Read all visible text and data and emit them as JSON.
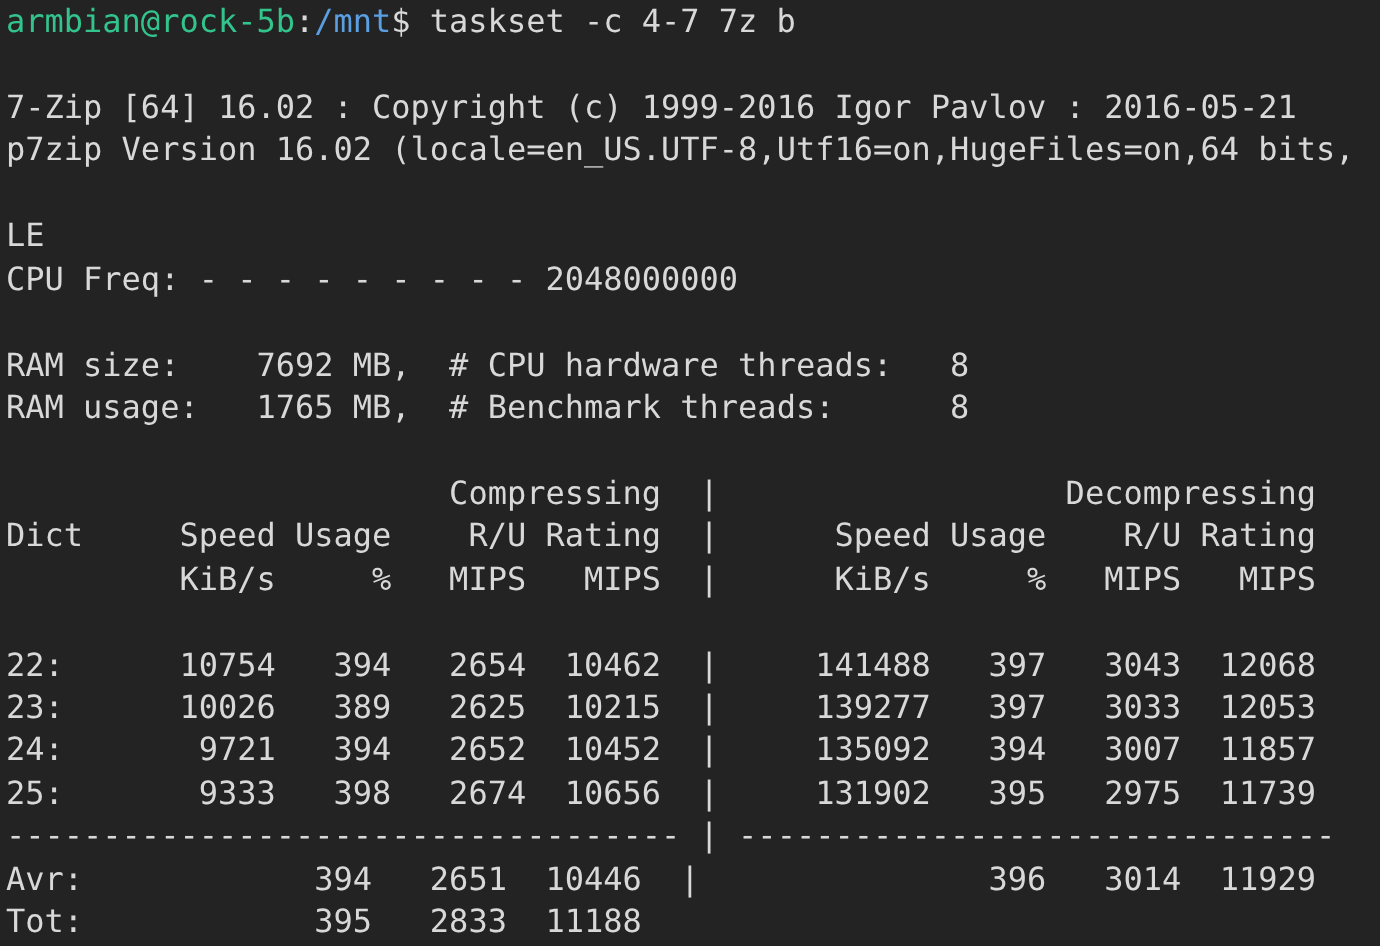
{
  "terminal": {
    "lines": [
      {
        "kind": "prompt",
        "user_host": "armbian@rock-5b",
        "separator": ":",
        "path": "/mnt",
        "symbol": "$",
        "command": "taskset -c 4-7 7z b"
      },
      {
        "kind": "blank"
      },
      {
        "kind": "text",
        "text": "7-Zip [64] 16.02 : Copyright (c) 1999-2016 Igor Pavlov : 2016-05-21"
      },
      {
        "kind": "text",
        "text": "p7zip Version 16.02 (locale=en_US.UTF-8,Utf16=on,HugeFiles=on,64 bits,"
      },
      {
        "kind": "blank"
      },
      {
        "kind": "text",
        "text": "LE"
      },
      {
        "kind": "text",
        "text": "CPU Freq: - - - - - - - - - 2048000000"
      },
      {
        "kind": "blank"
      },
      {
        "kind": "text",
        "text": "RAM size:    7692 MB,  # CPU hardware threads:   8"
      },
      {
        "kind": "text",
        "text": "RAM usage:   1765 MB,  # Benchmark threads:      8"
      },
      {
        "kind": "blank"
      },
      {
        "kind": "text",
        "text": "                       Compressing  |                  Decompressing"
      },
      {
        "kind": "text",
        "text": "Dict     Speed Usage    R/U Rating  |      Speed Usage    R/U Rating"
      },
      {
        "kind": "text",
        "text": "         KiB/s     %   MIPS   MIPS  |      KiB/s     %   MIPS   MIPS"
      },
      {
        "kind": "blank"
      },
      {
        "kind": "text",
        "text": "22:      10754   394   2654  10462  |     141488   397   3043  12068"
      },
      {
        "kind": "text",
        "text": "23:      10026   389   2625  10215  |     139277   397   3033  12053"
      },
      {
        "kind": "text",
        "text": "24:       9721   394   2652  10452  |     135092   394   3007  11857"
      },
      {
        "kind": "text",
        "text": "25:       9333   398   2674  10656  |     131902   395   2975  11739"
      },
      {
        "kind": "text",
        "text": "----------------------------------- | -------------------------------"
      },
      {
        "kind": "text",
        "text": "Avr:            394   2651  10446  |               396   3014  11929"
      },
      {
        "kind": "text",
        "text": "Tot:            395   2833  11188"
      }
    ]
  }
}
